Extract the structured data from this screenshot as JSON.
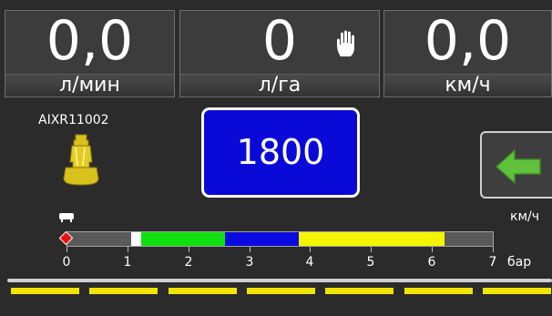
{
  "tiles": {
    "flow": {
      "value": "0,0",
      "unit": "л/мин"
    },
    "rate": {
      "value": "0",
      "unit": "л/га",
      "mode_icon": "hand-icon"
    },
    "speed": {
      "value": "0,0",
      "unit": "км/ч"
    }
  },
  "nozzle": {
    "label": "AIXR11002",
    "icon": "nozzle-icon",
    "color": "#d9c21b"
  },
  "target": {
    "value": "1800",
    "color": "#0a0ad8"
  },
  "back_button": {
    "icon": "arrow-left-icon",
    "color": "#5fc13c"
  },
  "speed_unit": "км/ч",
  "pressure_gauge": {
    "unit": "бар",
    "ticks": [
      "0",
      "1",
      "2",
      "3",
      "4",
      "5",
      "6",
      "7"
    ],
    "min": 0,
    "max": 7,
    "current": 0,
    "segments": [
      {
        "from": 0.0,
        "to": 1.05,
        "color": "#5a5a5a"
      },
      {
        "from": 1.05,
        "to": 1.22,
        "color": "#ffffff"
      },
      {
        "from": 1.22,
        "to": 2.6,
        "color": "#10e010"
      },
      {
        "from": 2.6,
        "to": 3.8,
        "color": "#0a0ae0"
      },
      {
        "from": 3.8,
        "to": 6.2,
        "color": "#f5f500"
      },
      {
        "from": 6.2,
        "to": 7.0,
        "color": "#5a5a5a"
      }
    ]
  },
  "boom": {
    "sections": 7,
    "section_color": "#f1e400"
  }
}
